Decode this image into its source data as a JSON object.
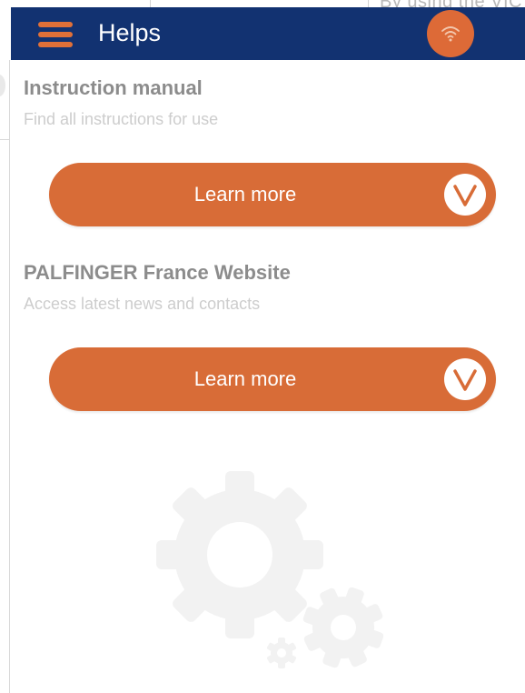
{
  "underlay": {
    "peek_text": "By using the VIC"
  },
  "header": {
    "title": "Helps",
    "bg_color": "#123271",
    "menu_icon": "hamburger-menu-icon",
    "status_icon": "wifi-icon",
    "accent_color": "#dd6a37"
  },
  "sections": [
    {
      "title": "Instruction manual",
      "subtitle": "Find all instructions for use",
      "button_label": "Learn more",
      "button_icon": "chevron-down-circle-icon"
    },
    {
      "title": "PALFINGER France Website",
      "subtitle": "Access latest news and contacts",
      "button_label": "Learn more",
      "button_icon": "chevron-down-circle-icon"
    }
  ],
  "decoration": {
    "icon": "gears-icon",
    "color": "#f2f2f2"
  },
  "colors": {
    "button": "#d86c37",
    "title_text": "#8c8c8c",
    "subtitle_text": "#cdcdcd"
  }
}
